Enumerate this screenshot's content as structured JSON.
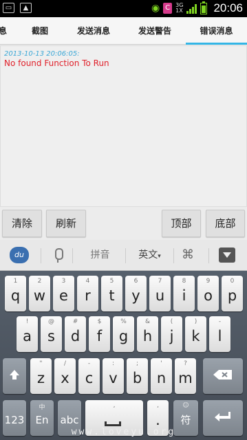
{
  "status_bar": {
    "time": "20:06",
    "network_badge": "C",
    "network_type_top": "3G",
    "network_type_bottom": "1X",
    "accent_color": "#7ed321"
  },
  "tabs": [
    {
      "label": "息"
    },
    {
      "label": "截图"
    },
    {
      "label": "发送消息"
    },
    {
      "label": "发送警告"
    },
    {
      "label": "错误消息",
      "active": true
    }
  ],
  "log": {
    "timestamp": "2013-10-13 20:06:05:",
    "message": "No found Function To Run",
    "timestamp_color": "#39a7d6",
    "message_color": "#e0202a"
  },
  "buttons": {
    "clear": "清除",
    "refresh": "刷新",
    "top": "顶部",
    "bottom": "底部"
  },
  "keyboard": {
    "toolbar": {
      "logo": "du",
      "pinyin": "拼音",
      "language": "英文",
      "language_caret": "▾",
      "grid_icon": "⌘"
    },
    "row1": [
      {
        "main": "q",
        "sub": "1"
      },
      {
        "main": "w",
        "sub": "2"
      },
      {
        "main": "e",
        "sub": "3"
      },
      {
        "main": "r",
        "sub": "4"
      },
      {
        "main": "t",
        "sub": "5"
      },
      {
        "main": "y",
        "sub": "6"
      },
      {
        "main": "u",
        "sub": "7"
      },
      {
        "main": "i",
        "sub": "8"
      },
      {
        "main": "o",
        "sub": "9"
      },
      {
        "main": "p",
        "sub": "0"
      }
    ],
    "row2": [
      {
        "main": "a",
        "sub": "!"
      },
      {
        "main": "s",
        "sub": "@"
      },
      {
        "main": "d",
        "sub": "#"
      },
      {
        "main": "f",
        "sub": "$"
      },
      {
        "main": "g",
        "sub": "%"
      },
      {
        "main": "h",
        "sub": "&"
      },
      {
        "main": "j",
        "sub": "("
      },
      {
        "main": "k",
        "sub": ")"
      },
      {
        "main": "l",
        "sub": "-"
      }
    ],
    "row3": [
      {
        "main": "z",
        "sub": "\""
      },
      {
        "main": "x",
        "sub": "/"
      },
      {
        "main": "c",
        "sub": "-"
      },
      {
        "main": "v",
        "sub": ":"
      },
      {
        "main": "b",
        "sub": ";"
      },
      {
        "main": "n",
        "sub": "'"
      },
      {
        "main": "m",
        "sub": "?"
      }
    ],
    "bottom": {
      "num": "123",
      "lang_top": "中",
      "lang_bottom": "En",
      "abc": "abc",
      "comma": ",",
      "period": ".",
      "sym_top": "☺",
      "sym_bottom": "符"
    },
    "watermark": "www.loveyu.org"
  }
}
